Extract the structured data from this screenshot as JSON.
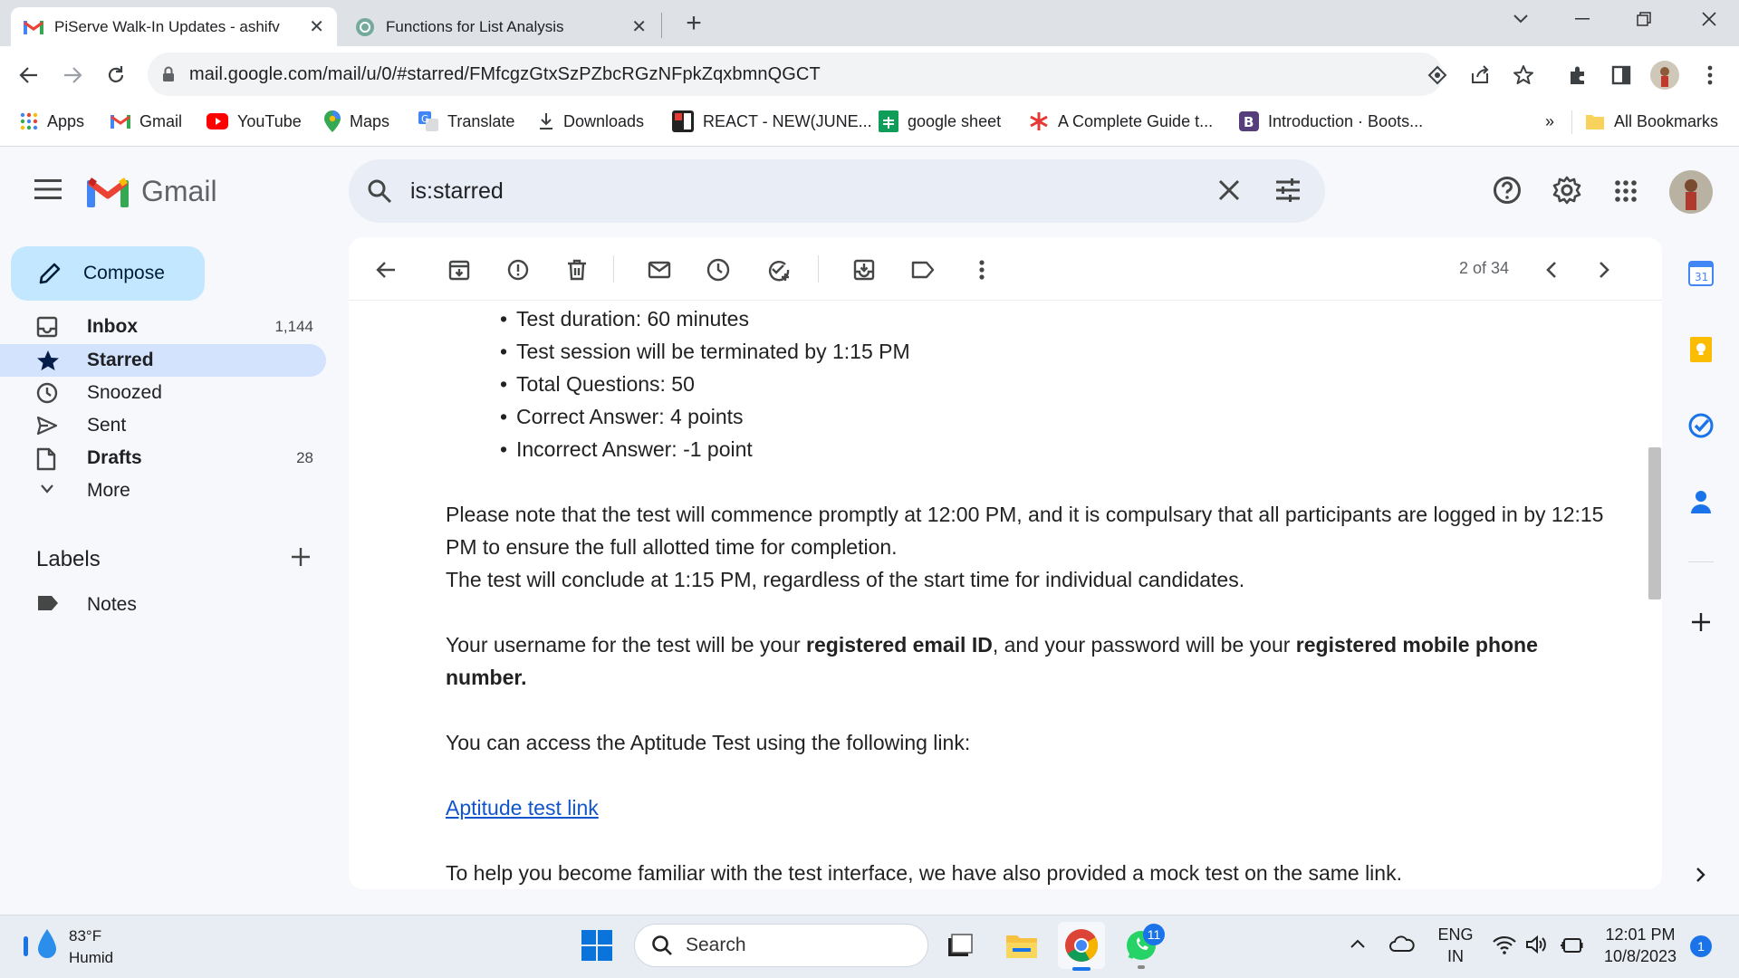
{
  "browser": {
    "tabs": [
      {
        "title": "PiServe Walk-In Updates - ashifv",
        "active": true
      },
      {
        "title": "Functions for List Analysis",
        "active": false
      }
    ],
    "url": "mail.google.com/mail/u/0/#starred/FMfcgzGtxSzPZbcRGzNFpkZqxbmnQGCT",
    "bookmarks": [
      "Apps",
      "Gmail",
      "YouTube",
      "Maps",
      "Translate",
      "Downloads",
      "REACT - NEW(JUNE...",
      "google sheet",
      "A Complete Guide t...",
      "Introduction · Boots..."
    ],
    "more_bookmarks": "»",
    "all_bookmarks": "All Bookmarks"
  },
  "gmail": {
    "logo_text": "Gmail",
    "search_query": "is:starred",
    "compose_label": "Compose",
    "nav": [
      {
        "label": "Inbox",
        "count": "1,144"
      },
      {
        "label": "Starred",
        "count": ""
      },
      {
        "label": "Snoozed",
        "count": ""
      },
      {
        "label": "Sent",
        "count": ""
      },
      {
        "label": "Drafts",
        "count": "28"
      },
      {
        "label": "More",
        "count": ""
      }
    ],
    "labels_heading": "Labels",
    "labels": [
      "Notes"
    ],
    "pagination": "2 of 34",
    "email": {
      "bullets": [
        "Test duration: 60 minutes",
        "Test session will be terminated by 1:15 PM",
        "Total Questions: 50",
        "Correct Answer: 4 points",
        "Incorrect Answer: -1 point"
      ],
      "p1a": "Please note that the test will commence promptly at 12:00 PM, and it is compulsary that all participants are logged in by 12:15 PM to ensure the full allotted time for completion.",
      "p1b": "The test will conclude at 1:15 PM, regardless of the start time for individual candidates.",
      "p2_pre": "Your username for the test will be your ",
      "p2_b1": "registered email ID",
      "p2_mid": ", and your password will be your ",
      "p2_b2": "registered mobile phone number.",
      "p3": "You can access the Aptitude Test using the following link:",
      "link": "Aptitude test link",
      "p4": "To help you become familiar with the test interface, we have also provided a mock test on the same link."
    }
  },
  "taskbar": {
    "weather_temp": "83°F",
    "weather_desc": "Humid",
    "search_label": "Search",
    "whatsapp_badge": "11",
    "lang_1": "ENG",
    "lang_2": "IN",
    "time": "12:01 PM",
    "date": "10/8/2023",
    "notif_count": "1"
  }
}
